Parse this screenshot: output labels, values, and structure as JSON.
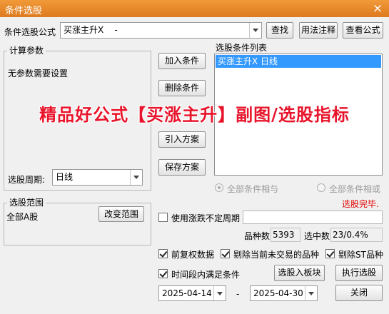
{
  "window": {
    "title": "条件选股",
    "close_glyph": "×"
  },
  "formula": {
    "label": "条件选股公式",
    "value": "买涨主升X    -",
    "find_btn": "查找",
    "usage_btn": "用法注释",
    "view_btn": "查看公式"
  },
  "params": {
    "group_title": "计算参数",
    "no_params": "无参数需要设置",
    "period_label": "选股周期:",
    "period_value": "日线"
  },
  "actions": {
    "add": "加入条件",
    "delete": "删除条件",
    "import": "引入方案",
    "save": "保存方案"
  },
  "condition_list": {
    "title": "选股条件列表",
    "items": [
      "买涨主升X  日线"
    ]
  },
  "logic": {
    "and_label": "全部条件相与",
    "or_label": "全部条件相或",
    "and_selected": true
  },
  "status": {
    "text": "选股完毕.",
    "color": "#e00000"
  },
  "scope": {
    "group_title": "选股范围",
    "value": "全部A股",
    "change_btn": "改变范围"
  },
  "options": {
    "use_range": "使用涨跌不定周期",
    "range_value": "",
    "adjust": "前复权数据",
    "exclude_no_trade": "剔除当前未交易的品种",
    "exclude_st": "剔除ST品种",
    "period_condition": "时间段内满足条件"
  },
  "stats": {
    "count_label": "品种数",
    "count_value": "5393",
    "selected_label": "选中数",
    "selected_value": "23/0.4%"
  },
  "dates": {
    "start": "2025-04-14",
    "separator": "-",
    "end": "2025-04-30"
  },
  "bottom": {
    "to_block": "选股入板块",
    "execute": "执行选股",
    "close": "关闭"
  },
  "overlay": {
    "text": "精品好公式【买涨主升】副图/选股指标",
    "color": "#e8142b"
  },
  "colors": {
    "titlebar": "#e9892d",
    "selection": "#3399ff"
  }
}
